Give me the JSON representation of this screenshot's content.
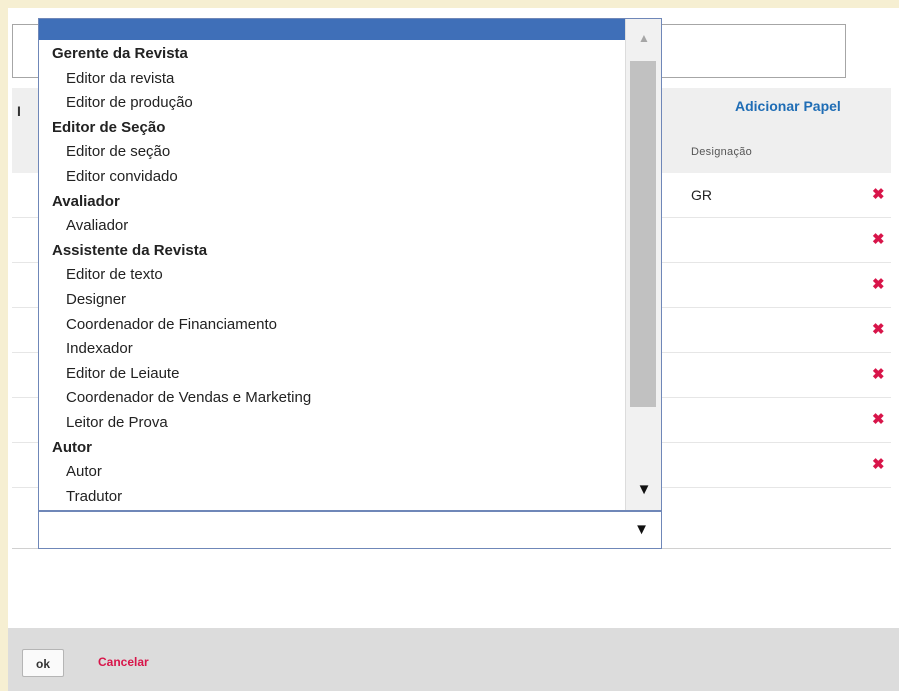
{
  "grid": {
    "add_role_label": "Adicionar Papel",
    "header_stub": "I",
    "designation_header": "Designação",
    "rows": [
      {
        "designation": "GR",
        "remove": "✖"
      },
      {
        "designation": "",
        "remove": "✖"
      },
      {
        "designation": "",
        "remove": "✖"
      },
      {
        "designation": "",
        "remove": "✖"
      },
      {
        "designation": "",
        "remove": "✖"
      },
      {
        "designation": "",
        "remove": "✖"
      },
      {
        "designation": "",
        "remove": "✖"
      }
    ]
  },
  "dropdown": {
    "options": [
      {
        "label": "Gerente da Revista",
        "type": "group"
      },
      {
        "label": "Editor da revista",
        "type": "item"
      },
      {
        "label": "Editor de produção",
        "type": "item"
      },
      {
        "label": "Editor de Seção",
        "type": "group"
      },
      {
        "label": "Editor de seção",
        "type": "item"
      },
      {
        "label": "Editor convidado",
        "type": "item"
      },
      {
        "label": "Avaliador",
        "type": "group"
      },
      {
        "label": "Avaliador",
        "type": "item"
      },
      {
        "label": "Assistente da Revista",
        "type": "group"
      },
      {
        "label": "Editor de texto",
        "type": "item"
      },
      {
        "label": "Designer",
        "type": "item"
      },
      {
        "label": "Coordenador de Financiamento",
        "type": "item"
      },
      {
        "label": "Indexador",
        "type": "item"
      },
      {
        "label": "Editor de Leiaute",
        "type": "item"
      },
      {
        "label": "Coordenador de Vendas e Marketing",
        "type": "item"
      },
      {
        "label": "Leitor de Prova",
        "type": "item"
      },
      {
        "label": "Autor",
        "type": "group"
      },
      {
        "label": "Autor",
        "type": "item"
      },
      {
        "label": "Tradutor",
        "type": "item"
      }
    ],
    "scroll_up_icon": "▲",
    "scroll_down_icon": "▼",
    "select_arrow_icon": "▼"
  },
  "footer": {
    "ok_label": "ok",
    "cancel_label": "Cancelar"
  },
  "colors": {
    "accent_blue": "#1f6db5",
    "danger": "#d8154a",
    "selection": "#3f6fb8"
  }
}
